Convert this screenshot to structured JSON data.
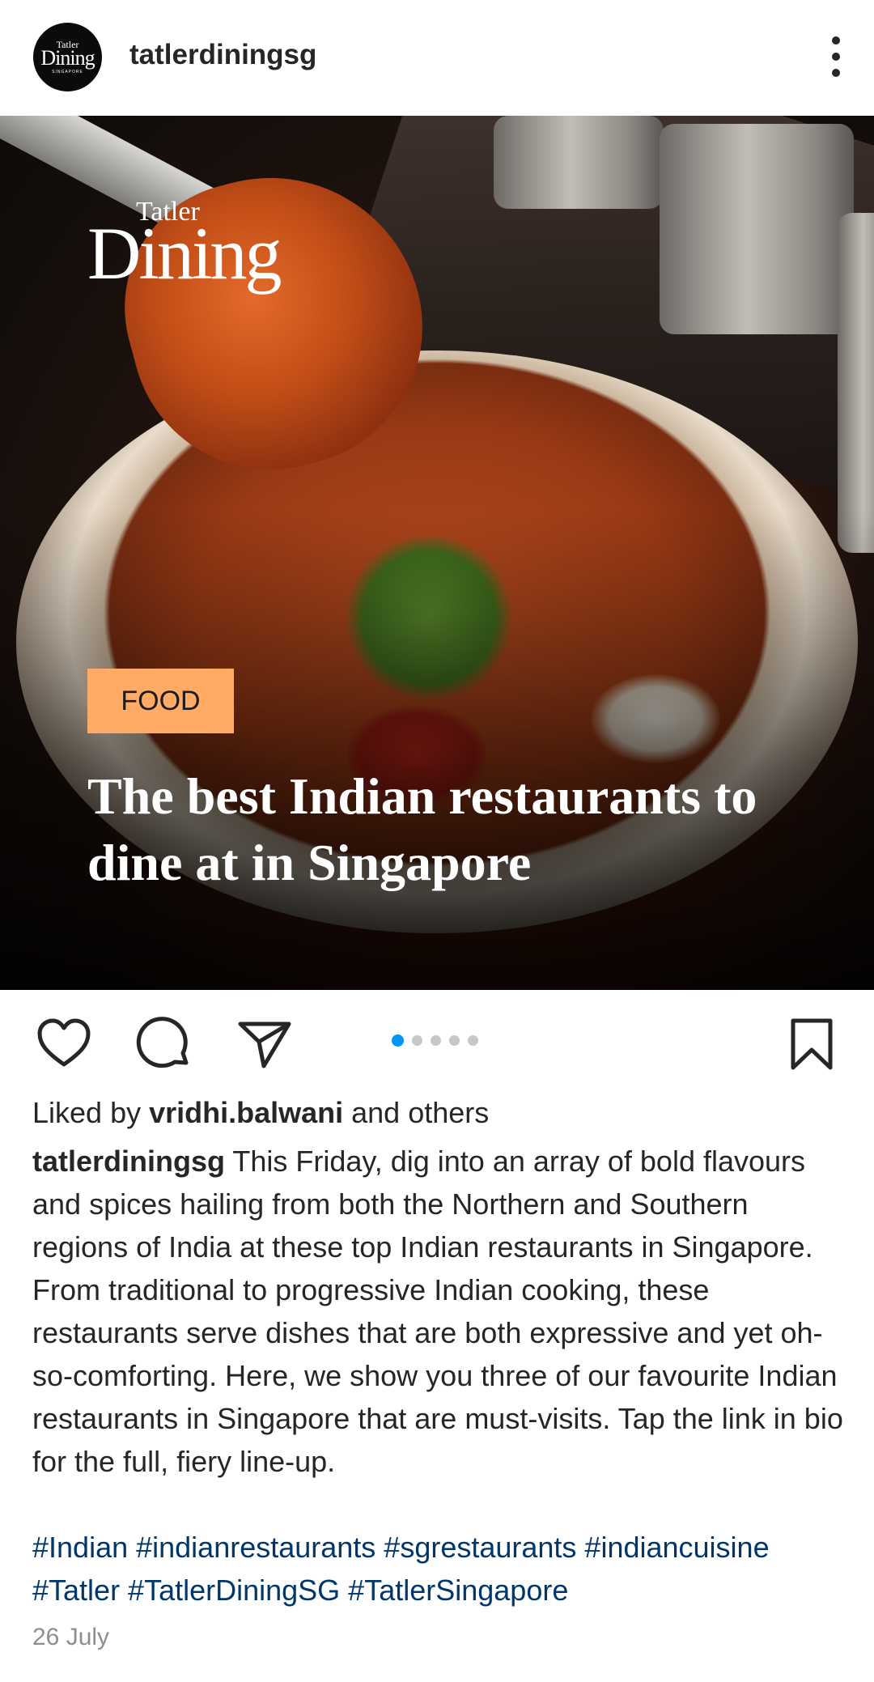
{
  "header": {
    "username": "tatlerdiningsg",
    "avatar_text": {
      "line1": "Tatler",
      "line2": "Dining",
      "line3": "SINGAPORE"
    }
  },
  "post_image": {
    "brand_line1": "Tatler",
    "brand_line2": "Dining",
    "tag": "FOOD",
    "headline": "The best Indian restaurants to dine at in Singapore"
  },
  "actions": {
    "carousel_count": 5,
    "carousel_active_index": 0
  },
  "likes": {
    "prefix": "Liked by ",
    "user": "vridhi.balwani",
    "suffix": " and others"
  },
  "caption": {
    "username": "tatlerdiningsg",
    "text": " This Friday, dig into an array of bold flavours and spices hailing from both the Northern and Southern regions of India at these top Indian restaurants in Singapore. From traditional to progressive Indian cooking, these restaurants serve dishes that are both expressive and yet oh-so-comforting. Here, we show you three of our favourite Indian restaurants in Singapore that are must-visits. Tap the link in bio for the full, fiery line-up.",
    "hashtags": "#Indian #indianrestaurants #sgrestaurants #indiancuisine #Tatler #TatlerDiningSG #TatlerSingapore"
  },
  "date": "26 July",
  "colors": {
    "tag_bg": "#ffab66",
    "hashtag": "#00376b",
    "carousel_active": "#0095f6"
  }
}
